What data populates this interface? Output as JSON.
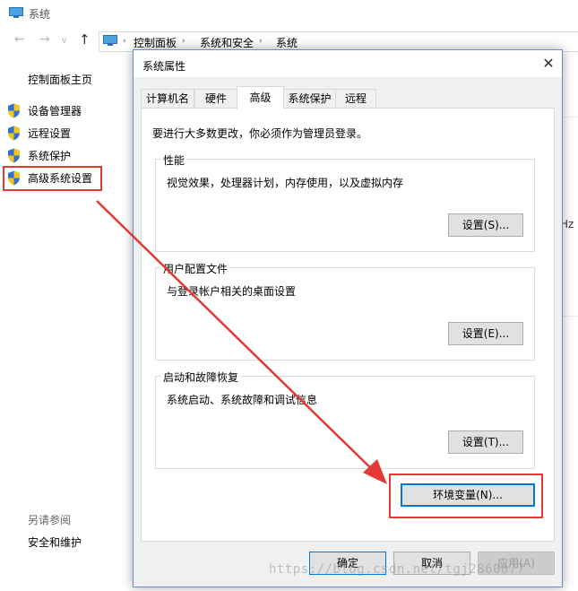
{
  "window": {
    "title": "系统"
  },
  "address_bar": {
    "crumbs": [
      "控制面板",
      "系统和安全",
      "系统"
    ]
  },
  "sidebar": {
    "home": "控制面板主页",
    "items": [
      {
        "label": "设备管理器",
        "icon": "shield-icon"
      },
      {
        "label": "远程设置",
        "icon": "shield-icon"
      },
      {
        "label": "系统保护",
        "icon": "shield-icon"
      },
      {
        "label": "高级系统设置",
        "icon": "shield-icon",
        "highlighted": true
      }
    ],
    "see_also_title": "另请参阅",
    "see_also_items": [
      "安全和维护"
    ]
  },
  "background_partial_text": "Hz",
  "dialog": {
    "title": "系统属性",
    "close_icon": "close-icon",
    "tabs": [
      {
        "label": "计算机名"
      },
      {
        "label": "硬件"
      },
      {
        "label": "高级",
        "active": true
      },
      {
        "label": "系统保护"
      },
      {
        "label": "远程"
      }
    ],
    "admin_note": "要进行大多数更改，你必须作为管理员登录。",
    "groups": [
      {
        "title": "性能",
        "desc": "视觉效果，处理器计划，内存使用，以及虚拟内存",
        "button": "设置(S)..."
      },
      {
        "title": "用户配置文件",
        "desc": "与登录帐户相关的桌面设置",
        "button": "设置(E)..."
      },
      {
        "title": "启动和故障恢复",
        "desc": "系统启动、系统故障和调试信息",
        "button": "设置(T)..."
      }
    ],
    "env_button": "环境变量(N)...",
    "footer": {
      "ok": "确定",
      "cancel": "取消",
      "apply": "应用(A)"
    }
  },
  "watermark": "https://blog.csdn.net/tgj2860077",
  "colors": {
    "highlight": "#e53935",
    "accent": "#0078d7",
    "shield_blue": "#2f6fd6",
    "shield_yellow": "#f5c518"
  }
}
